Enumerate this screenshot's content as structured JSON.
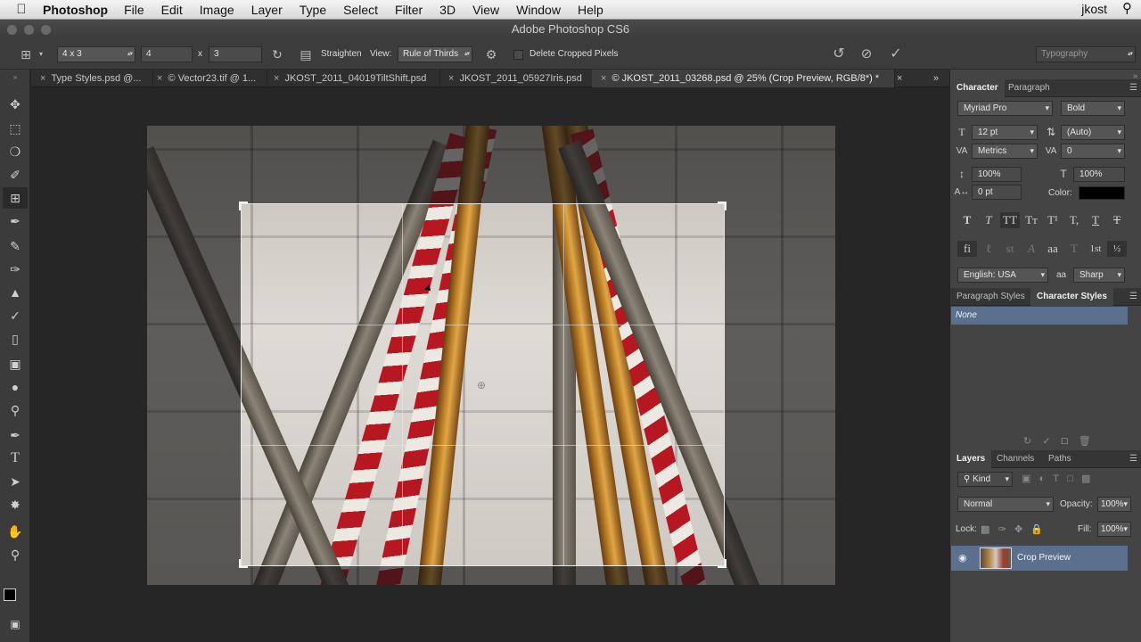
{
  "menubar": {
    "app_name": "Photoshop",
    "items": [
      "File",
      "Edit",
      "Image",
      "Layer",
      "Type",
      "Select",
      "Filter",
      "3D",
      "View",
      "Window",
      "Help"
    ],
    "user": "jkost"
  },
  "window": {
    "title": "Adobe Photoshop CS6"
  },
  "options": {
    "ratio_preset": "4 x 3",
    "width": "4",
    "times": "x",
    "height": "3",
    "straighten_label": "Straighten",
    "view_label": "View:",
    "view_value": "Rule of Thirds",
    "delete_cropped_label": "Delete Cropped Pixels",
    "workspace": "Typography"
  },
  "tabs": [
    {
      "label": "Type Styles.psd @..."
    },
    {
      "label": "© Vector23.tif @ 1..."
    },
    {
      "label": "JKOST_2011_04019TiltShift.psd"
    },
    {
      "label": "JKOST_2011_05927Iris.psd"
    },
    {
      "label": "© JKOST_2011_03268.psd @ 25% (Crop Preview, RGB/8*) *"
    }
  ],
  "character": {
    "tab_character": "Character",
    "tab_paragraph": "Paragraph",
    "font_family": "Myriad Pro",
    "font_style": "Bold",
    "font_size": "12 pt",
    "leading": "(Auto)",
    "kerning": "Metrics",
    "tracking": "0",
    "vertical_scale": "100%",
    "horizontal_scale": "100%",
    "baseline_shift": "0 pt",
    "color_label": "Color:",
    "language": "English: USA",
    "aa_symbol": "aa",
    "antialias": "Sharp"
  },
  "styles": {
    "tab_paragraph_styles": "Paragraph Styles",
    "tab_character_styles": "Character Styles",
    "selected": "None"
  },
  "layers": {
    "tab_layers": "Layers",
    "tab_channels": "Channels",
    "tab_paths": "Paths",
    "filter_kind": "Kind",
    "blend_mode": "Normal",
    "opacity_label": "Opacity:",
    "opacity": "100%",
    "lock_label": "Lock:",
    "fill_label": "Fill:",
    "fill": "100%",
    "layer_name": "Crop Preview"
  },
  "colors": {
    "panel_bg": "#444444",
    "selection_blue": "#5b6f8e",
    "text_color_swatch": "#000000"
  }
}
